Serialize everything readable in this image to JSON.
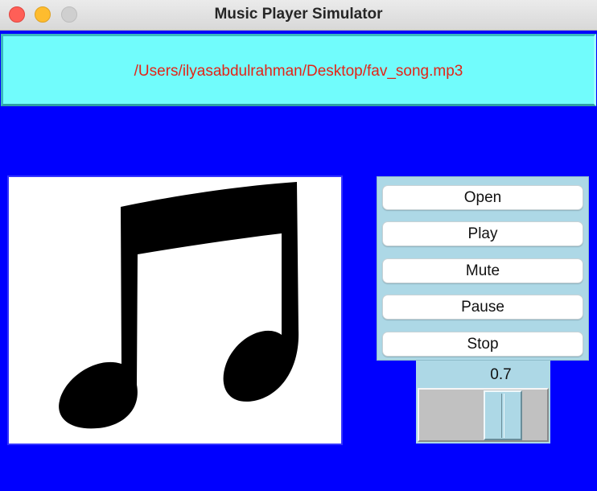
{
  "window": {
    "title": "Music Player Simulator",
    "background_color": "#0000ff"
  },
  "path_display": {
    "text": "/Users/ilyasabdulrahman/Desktop/fav_song.mp3",
    "background_color": "#71fcfc",
    "text_color": "#e32418"
  },
  "album_art": {
    "icon": "music-note-icon"
  },
  "controls": {
    "buttons": [
      {
        "label": "Open"
      },
      {
        "label": "Play"
      },
      {
        "label": "Mute"
      },
      {
        "label": "Pause"
      },
      {
        "label": "Stop"
      }
    ],
    "panel_color": "#add8e6"
  },
  "volume": {
    "value": "0.7",
    "level": 0.7
  }
}
